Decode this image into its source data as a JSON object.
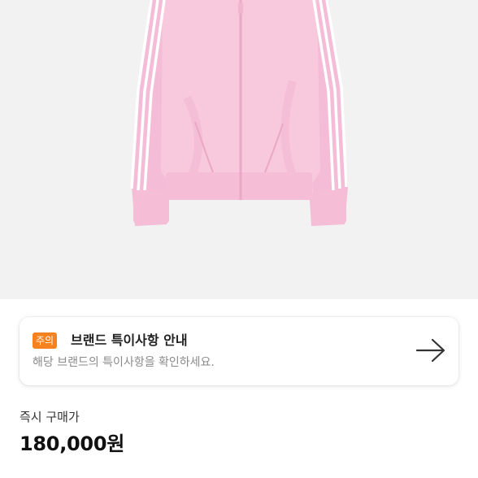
{
  "product_image": {
    "icon": "pink-track-jacket-image",
    "colors": {
      "background": "#f2f2f2",
      "jacket": "#f7c4dc",
      "stripe": "#ffffff"
    }
  },
  "notice": {
    "badge": "주의",
    "title": "브랜드 특이사항 안내",
    "description": "해당 브랜드의 특이사항을 확인하세요.",
    "arrow_icon": "arrow-right-icon",
    "badge_color": "#f6811f"
  },
  "price": {
    "label": "즉시 구매가",
    "value": "180,000원"
  }
}
